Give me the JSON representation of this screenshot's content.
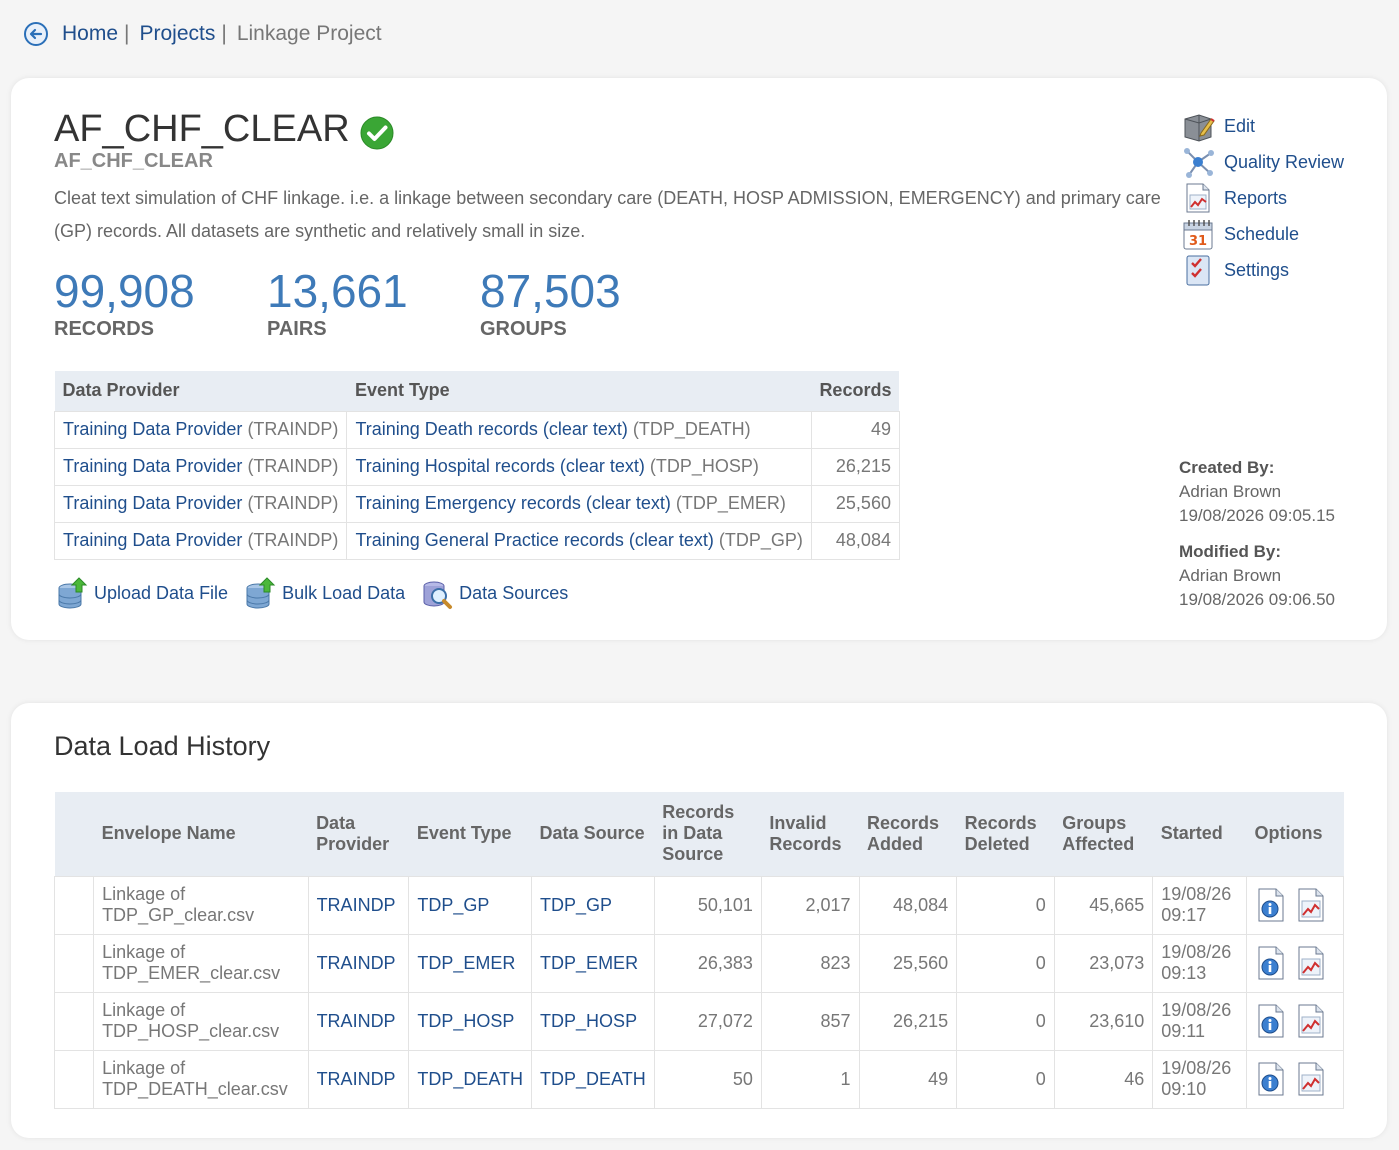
{
  "breadcrumb": {
    "home": "Home",
    "projects": "Projects",
    "current": "Linkage Project",
    "sep": "|"
  },
  "project": {
    "title": "AF_CHF_CLEAR",
    "subtitle": "AF_CHF_CLEAR",
    "description": "Cleat text simulation of CHF linkage. i.e. a linkage between secondary care (DEATH, HOSP ADMISSION, EMERGENCY) and primary care (GP) records. All datasets are synthetic and relatively small in size.",
    "stats": [
      {
        "value": "99,908",
        "label": "RECORDS"
      },
      {
        "value": "13,661",
        "label": "PAIRS"
      },
      {
        "value": "87,503",
        "label": "GROUPS"
      }
    ]
  },
  "provider_table": {
    "headers": [
      "Data Provider",
      "Event Type",
      "Records"
    ],
    "rows": [
      {
        "provider": "Training Data Provider",
        "provider_code": "(TRAINDP)",
        "event": "Training Death records (clear text)",
        "event_code": "(TDP_DEATH)",
        "records": "49"
      },
      {
        "provider": "Training Data Provider",
        "provider_code": "(TRAINDP)",
        "event": "Training Hospital records (clear text)",
        "event_code": "(TDP_HOSP)",
        "records": "26,215"
      },
      {
        "provider": "Training Data Provider",
        "provider_code": "(TRAINDP)",
        "event": "Training Emergency records (clear text)",
        "event_code": "(TDP_EMER)",
        "records": "25,560"
      },
      {
        "provider": "Training Data Provider",
        "provider_code": "(TRAINDP)",
        "event": "Training General Practice records (clear text)",
        "event_code": "(TDP_GP)",
        "records": "48,084"
      }
    ]
  },
  "actions": {
    "upload": "Upload Data File",
    "bulk": "Bulk Load Data",
    "sources": "Data Sources"
  },
  "side_menu": {
    "edit": "Edit",
    "quality": "Quality Review",
    "reports": "Reports",
    "schedule": "Schedule",
    "settings": "Settings",
    "calendar_day": "31"
  },
  "meta": {
    "created_label": "Created By:",
    "created_by": "Adrian Brown",
    "created_at": "19/08/2026 09:05.15",
    "modified_label": "Modified By:",
    "modified_by": "Adrian Brown",
    "modified_at": "19/08/2026 09:06.50"
  },
  "history": {
    "title": "Data Load History",
    "headers": {
      "envelope": "Envelope Name",
      "provider": "Data Provider",
      "event": "Event Type",
      "source": "Data Source",
      "records_source": "Records in Data Source",
      "invalid": "Invalid Records",
      "added": "Records Added",
      "deleted": "Records Deleted",
      "groups": "Groups Affected",
      "started": "Started",
      "options": "Options"
    },
    "rows": [
      {
        "envelope": "Linkage of TDP_GP_clear.csv",
        "provider": "TRAINDP",
        "event": "TDP_GP",
        "source": "TDP_GP",
        "records_source": "50,101",
        "invalid": "2,017",
        "added": "48,084",
        "deleted": "0",
        "groups": "45,665",
        "started_date": "19/08/26",
        "started_time": "09:17"
      },
      {
        "envelope": "Linkage of TDP_EMER_clear.csv",
        "provider": "TRAINDP",
        "event": "TDP_EMER",
        "source": "TDP_EMER",
        "records_source": "26,383",
        "invalid": "823",
        "added": "25,560",
        "deleted": "0",
        "groups": "23,073",
        "started_date": "19/08/26",
        "started_time": "09:13"
      },
      {
        "envelope": "Linkage of TDP_HOSP_clear.csv",
        "provider": "TRAINDP",
        "event": "TDP_HOSP",
        "source": "TDP_HOSP",
        "records_source": "27,072",
        "invalid": "857",
        "added": "26,215",
        "deleted": "0",
        "groups": "23,610",
        "started_date": "19/08/26",
        "started_time": "09:11"
      },
      {
        "envelope": "Linkage of TDP_DEATH_clear.csv",
        "provider": "TRAINDP",
        "event": "TDP_DEATH",
        "source": "TDP_DEATH",
        "records_source": "50",
        "invalid": "1",
        "added": "49",
        "deleted": "0",
        "groups": "46",
        "started_date": "19/08/26",
        "started_time": "09:10"
      }
    ]
  },
  "colors": {
    "link": "#1f4e8c",
    "stat": "#3e7ab8",
    "header_bg": "#e8edf3",
    "success": "#3aa635"
  }
}
